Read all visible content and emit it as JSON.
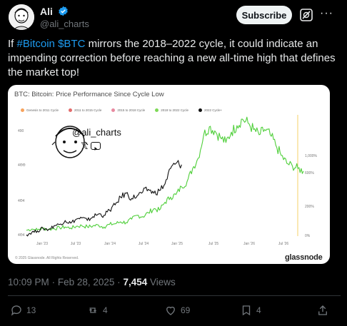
{
  "author": {
    "name": "Ali",
    "handle": "@ali_charts",
    "verified": true
  },
  "header": {
    "subscribe_label": "Subscribe",
    "more_label": "···"
  },
  "tweet": {
    "text_prefix": "If ",
    "hashtag": "#Bitcoin",
    "cashtag": "$BTC",
    "text_rest": " mirrors the 2018–2022 cycle, it could indicate an impending correction before reaching a new all-time high that defines the market top!"
  },
  "card": {
    "title": "BTC: Bitcoin: Price Performance Since Cycle Low",
    "legend": [
      {
        "label": "Genesis to 2011 Cycle",
        "color": "#f7a35c"
      },
      {
        "label": "2011 to 2015 Cycle",
        "color": "#e36c6c"
      },
      {
        "label": "2015 to 2018 Cycle",
        "color": "#e88aa0"
      },
      {
        "label": "2018 to 2022 Cycle",
        "color": "#7ed957"
      },
      {
        "label": "2022 Cycle+",
        "color": "#111111"
      }
    ],
    "watermark_handle": "@ali_charts",
    "copyright": "© 2025 Glassnode. All Rights Reserved.",
    "brand": "glassnode"
  },
  "chart_data": {
    "type": "line",
    "title": "BTC: Bitcoin: Price Performance Since Cycle Low",
    "x_ticks": [
      "Jan '23",
      "Jul '23",
      "Jan '24",
      "Jul '24",
      "Jan '25",
      "Jul '25",
      "Jan '26",
      "Jul '26"
    ],
    "y_left_ticks": [
      "490",
      "4ΘΘ",
      "4Θ4",
      "4Θ4"
    ],
    "y_right_ticks": [
      "1,000%",
      "600%",
      "200%",
      "0%"
    ],
    "series": [
      {
        "name": "2018 to 2022 Cycle",
        "color": "#4fcf3a",
        "x": [
          0,
          2,
          4,
          6,
          8,
          10,
          12,
          14,
          16,
          18,
          20,
          22,
          24,
          26,
          28,
          30,
          32,
          34,
          36,
          38,
          40,
          42,
          44,
          46,
          48,
          50,
          52,
          54,
          56,
          58,
          60,
          62,
          64,
          66,
          68,
          70,
          72,
          74,
          76,
          78,
          80,
          82,
          84,
          86,
          88,
          90,
          92,
          94,
          96,
          98,
          100
        ],
        "values": [
          45,
          55,
          48,
          60,
          52,
          58,
          65,
          70,
          62,
          75,
          80,
          72,
          78,
          85,
          70,
          90,
          95,
          110,
          105,
          130,
          160,
          150,
          180,
          210,
          200,
          260,
          300,
          320,
          380,
          420,
          520,
          600,
          780,
          840,
          810,
          760,
          720,
          800,
          850,
          900,
          870,
          820,
          780,
          820,
          780,
          700,
          620,
          560,
          540,
          520,
          500
        ]
      },
      {
        "name": "2022 Cycle+",
        "color": "#111111",
        "x": [
          0,
          2,
          4,
          6,
          8,
          10,
          12,
          14,
          16,
          18,
          20,
          22,
          24,
          26,
          28,
          30,
          32,
          34,
          36,
          38,
          40,
          42,
          44,
          46,
          48,
          50,
          52,
          54,
          56
        ],
        "values": [
          10,
          30,
          40,
          60,
          50,
          80,
          90,
          120,
          100,
          130,
          140,
          120,
          150,
          170,
          160,
          200,
          240,
          300,
          330,
          290,
          310,
          340,
          360,
          330,
          350,
          400,
          520,
          560,
          550
        ]
      }
    ],
    "grid": false,
    "legend_placement": "top-left"
  },
  "meta": {
    "time": "10:09 PM",
    "date": "Feb 28, 2025",
    "views_count": "7,454",
    "views_label": "Views",
    "separator": "·"
  },
  "actions": {
    "replies": "13",
    "reposts": "4",
    "likes": "69",
    "bookmarks": "4"
  },
  "colors": {
    "background": "#000000",
    "link": "#1d9bf0",
    "muted": "#71767b",
    "divider": "#2f3336"
  }
}
